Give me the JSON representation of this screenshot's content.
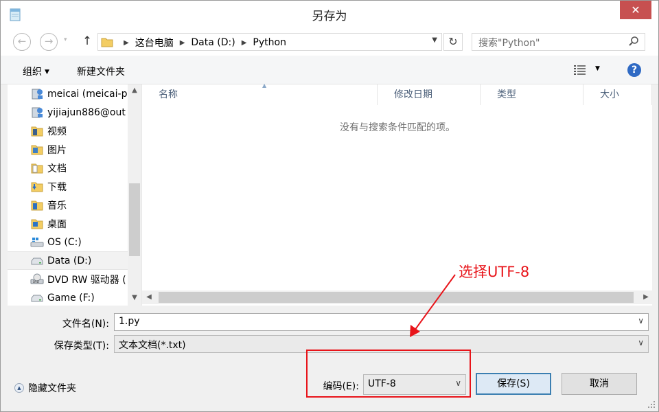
{
  "window": {
    "title": "另存为",
    "close_glyph": "✕"
  },
  "nav_buttons": {
    "back_glyph": "←",
    "forward_glyph": "→",
    "up_glyph": "↑",
    "recent_glyph": "▾",
    "refresh_glyph": "↻"
  },
  "breadcrumbs": [
    {
      "label": "这台电脑"
    },
    {
      "label": "Data (D:)"
    },
    {
      "label": "Python"
    }
  ],
  "search": {
    "placeholder": "搜索\"Python\""
  },
  "toolbar": {
    "organize_label": "组织",
    "new_folder_label": "新建文件夹",
    "help_glyph": "?"
  },
  "sidebar": {
    "items": [
      {
        "label": "meicai (meicai-p",
        "icon": "user-icon"
      },
      {
        "label": "yijiajun886@out",
        "icon": "user-icon"
      },
      {
        "label": "视频",
        "icon": "videos-folder-icon"
      },
      {
        "label": "图片",
        "icon": "pictures-folder-icon"
      },
      {
        "label": "文档",
        "icon": "documents-folder-icon"
      },
      {
        "label": "下载",
        "icon": "downloads-folder-icon"
      },
      {
        "label": "音乐",
        "icon": "music-folder-icon"
      },
      {
        "label": "桌面",
        "icon": "desktop-folder-icon"
      },
      {
        "label": "OS (C:)",
        "icon": "windows-drive-icon"
      },
      {
        "label": "Data (D:)",
        "icon": "drive-icon",
        "selected": true
      },
      {
        "label": "DVD RW 驱动器 (",
        "icon": "dvd-drive-icon"
      },
      {
        "label": "Game (F:)",
        "icon": "drive-icon"
      }
    ]
  },
  "file_list": {
    "columns": [
      "名称",
      "修改日期",
      "类型",
      "大小"
    ],
    "empty_message": "没有与搜索条件匹配的项。"
  },
  "form": {
    "filename_label": "文件名(N):",
    "filename_value": "1.py",
    "filetype_label": "保存类型(T):",
    "filetype_value": "文本文档(*.txt)",
    "encoding_label": "编码(E):",
    "encoding_value": "UTF-8"
  },
  "buttons": {
    "hide_folders_label": "隐藏文件夹",
    "save_label": "保存(S)",
    "cancel_label": "取消"
  },
  "annotation": {
    "text": "选择UTF-8",
    "color": "#e8141a"
  },
  "colors": {
    "accent_blue": "#2f6ac4",
    "close_red": "#c75050",
    "header_text": "#4c607a"
  }
}
